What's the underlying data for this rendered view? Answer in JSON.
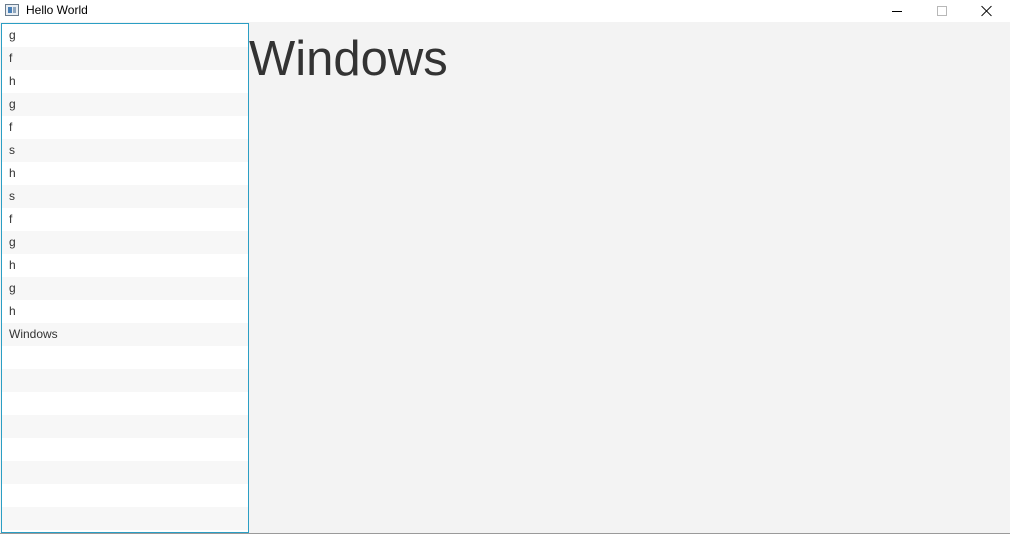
{
  "window": {
    "title": "Hello World",
    "icon": "java-window-icon",
    "controls": {
      "minimize_icon": "minimize-icon",
      "maximize_icon": "maximize-icon",
      "close_icon": "close-icon"
    }
  },
  "list": {
    "items": [
      "g",
      "f",
      "h",
      "g",
      "f",
      "s",
      "h",
      "s",
      "f",
      "g",
      "h",
      "g",
      "h",
      "Windows"
    ],
    "selection_border_color": "#2b9ec4"
  },
  "main": {
    "heading": "Windows"
  },
  "colors": {
    "background": "#f3f3f3",
    "text": "#333333",
    "list_alt_row": "#f7f7f7"
  }
}
